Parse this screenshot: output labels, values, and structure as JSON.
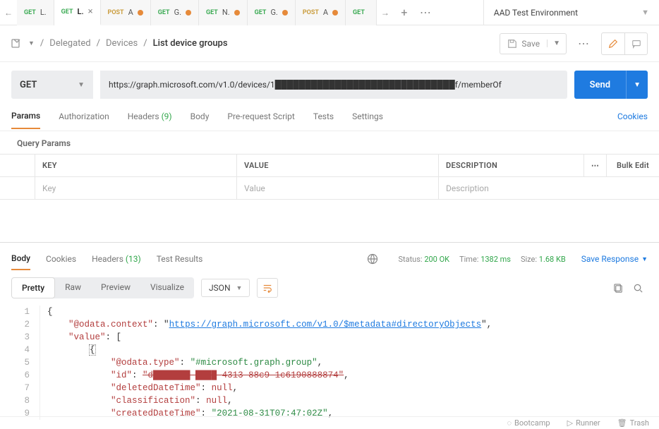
{
  "environment": "AAD Test Environment",
  "tabs": [
    {
      "method": "GET",
      "name": "L.",
      "active": false
    },
    {
      "method": "GET",
      "name": "L.",
      "active": true
    },
    {
      "method": "POST",
      "name": "A",
      "active": false,
      "dirty": true
    },
    {
      "method": "GET",
      "name": "G.",
      "active": false,
      "dirty": true
    },
    {
      "method": "GET",
      "name": "N.",
      "active": false,
      "dirty": true
    },
    {
      "method": "GET",
      "name": "G.",
      "active": false,
      "dirty": true
    },
    {
      "method": "POST",
      "name": "A",
      "active": false,
      "dirty": true
    },
    {
      "method": "GET",
      "name": "",
      "active": false
    }
  ],
  "breadcrumb": {
    "level1": "Delegated",
    "level2": "Devices",
    "current": "List device groups"
  },
  "save_label": "Save",
  "method": "GET",
  "url": "https://graph.microsoft.com/v1.0/devices/1██████████████████████████████f/memberOf",
  "send_label": "Send",
  "req_tabs": {
    "params": "Params",
    "authorization": "Authorization",
    "headers": "Headers",
    "headers_count": "(9)",
    "body": "Body",
    "pre_request": "Pre-request Script",
    "tests": "Tests",
    "settings": "Settings",
    "cookies": "Cookies"
  },
  "query_params_title": "Query Params",
  "qp_headers": {
    "key": "KEY",
    "value": "VALUE",
    "description": "DESCRIPTION",
    "bulk": "Bulk Edit"
  },
  "qp_placeholders": {
    "key": "Key",
    "value": "Value",
    "description": "Description"
  },
  "resp_tabs": {
    "body": "Body",
    "cookies": "Cookies",
    "headers": "Headers",
    "headers_count": "(13)",
    "test_results": "Test Results"
  },
  "status": {
    "label": "Status:",
    "value": "200 OK"
  },
  "time": {
    "label": "Time:",
    "value": "1382 ms"
  },
  "size": {
    "label": "Size:",
    "value": "1.68 KB"
  },
  "save_response": "Save Response",
  "view_tabs": {
    "pretty": "Pretty",
    "raw": "Raw",
    "preview": "Preview",
    "visualize": "Visualize"
  },
  "format": "JSON",
  "json": {
    "odata_context_key": "\"@odata.context\"",
    "odata_context_val": "https://graph.microsoft.com/v1.0/$metadata#directoryObjects",
    "value_key": "\"value\"",
    "odata_type_key": "\"@odata.type\"",
    "odata_type_val": "\"#microsoft.graph.group\"",
    "id_key": "\"id\"",
    "id_val": "\"d███████-████-4313-88c9-1c6190888874\"",
    "deleted_key": "\"deletedDateTime\"",
    "classification_key": "\"classification\"",
    "created_key": "\"createdDateTime\"",
    "created_val": "\"2021-08-31T07:47:02Z\"",
    "null_tok": "null"
  },
  "footer": {
    "bootcamp": "Bootcamp",
    "runner": "Runner",
    "trash": "Trash"
  }
}
